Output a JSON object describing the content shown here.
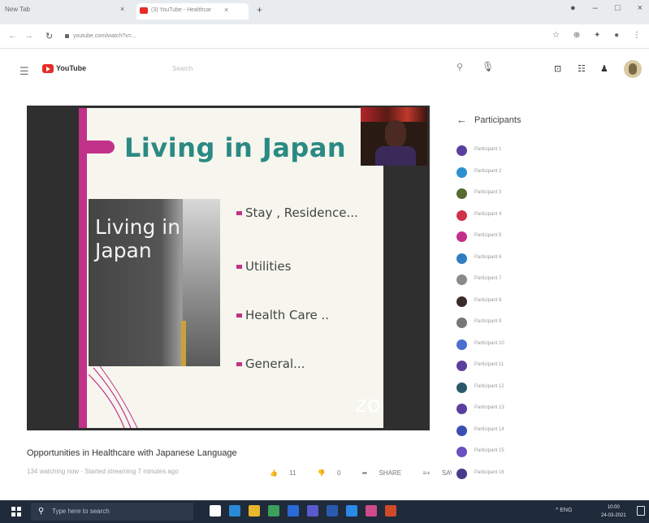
{
  "browser": {
    "new_tab_label": "New Tab",
    "active_tab_title": "(3) YouTube - Healthcar",
    "address": "youtube.com/watch?v=...",
    "icons": [
      "back-arrow",
      "forward-arrow",
      "reload",
      "lock",
      "extensions",
      "profile"
    ]
  },
  "youtube": {
    "logo_text": "YouTube",
    "search_placeholder": "Search"
  },
  "video": {
    "slide": {
      "title": "Living in Japan",
      "photo_caption": "Living in\nJapan",
      "bullets": [
        "Stay , Residence...",
        "Utilities",
        "Health Care ..",
        "General..."
      ],
      "watermark": "zoom"
    },
    "title": "Opportunities in Healthcare with Japanese Language",
    "meta": "134 watching now · Started streaming 7 minutes ago",
    "actions": {
      "like": "11",
      "dislike": "0",
      "share": "SHARE",
      "save": "SAVE",
      "more": "..."
    }
  },
  "participants": {
    "title": "Participants",
    "list": [
      {
        "name": "Participant 1",
        "color": "#5a3fa0"
      },
      {
        "name": "Participant 2",
        "color": "#2d8fd0"
      },
      {
        "name": "Participant 3",
        "color": "#556b2f"
      },
      {
        "name": "Participant 4",
        "color": "#d0304a"
      },
      {
        "name": "Participant 5",
        "color": "#c2308a"
      },
      {
        "name": "Participant 6",
        "color": "#2f7fc0"
      },
      {
        "name": "Participant 7",
        "color": "#8a8a8a"
      },
      {
        "name": "Participant 8",
        "color": "#3a2a2a"
      },
      {
        "name": "Participant 9",
        "color": "#777777"
      },
      {
        "name": "Participant 10",
        "color": "#4a6fd0"
      },
      {
        "name": "Participant 11",
        "color": "#5a3fa0"
      },
      {
        "name": "Participant 12",
        "color": "#2a5a6a"
      },
      {
        "name": "Participant 13",
        "color": "#5a3fa0"
      },
      {
        "name": "Participant 14",
        "color": "#3a4fb0"
      },
      {
        "name": "Participant 15",
        "color": "#6a4fc0"
      },
      {
        "name": "Participant 16",
        "color": "#4a3a8a"
      }
    ]
  },
  "taskbar": {
    "search_placeholder": "Type here to search",
    "apps": [
      {
        "name": "task-view",
        "color": "#ffffff"
      },
      {
        "name": "edge",
        "color": "#2a8ad8"
      },
      {
        "name": "file-explorer",
        "color": "#e8b82a"
      },
      {
        "name": "chrome",
        "color": "#3aa05a"
      },
      {
        "name": "outlook",
        "color": "#2a6ad8"
      },
      {
        "name": "teams",
        "color": "#5a5ad0"
      },
      {
        "name": "word",
        "color": "#2a5ab0"
      },
      {
        "name": "zoom",
        "color": "#2a8ae8"
      },
      {
        "name": "store",
        "color": "#d04a8a"
      },
      {
        "name": "powerpoint",
        "color": "#d04a2a"
      }
    ],
    "tray": "^ ENG",
    "time": "10:00",
    "date": "24-03-2021"
  }
}
